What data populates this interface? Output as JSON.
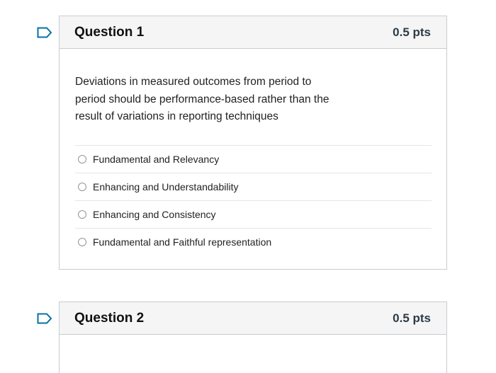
{
  "questions": [
    {
      "title": "Question 1",
      "points": "0.5 pts",
      "text": "Deviations in measured outcomes from period to period should be performance-based rather than the result of variations in reporting techniques",
      "answers": [
        "Fundamental and Relevancy",
        "Enhancing and Understandability",
        "Enhancing and Consistency",
        "Fundamental and Faithful representation"
      ]
    },
    {
      "title": "Question 2",
      "points": "0.5 pts"
    }
  ],
  "colors": {
    "flag_icon": "#0770a3",
    "header_bg": "#f5f5f5",
    "border": "#c7cdd1"
  },
  "icons": {
    "flag": "flag-question-icon",
    "radio": "radio-unselected-icon"
  }
}
